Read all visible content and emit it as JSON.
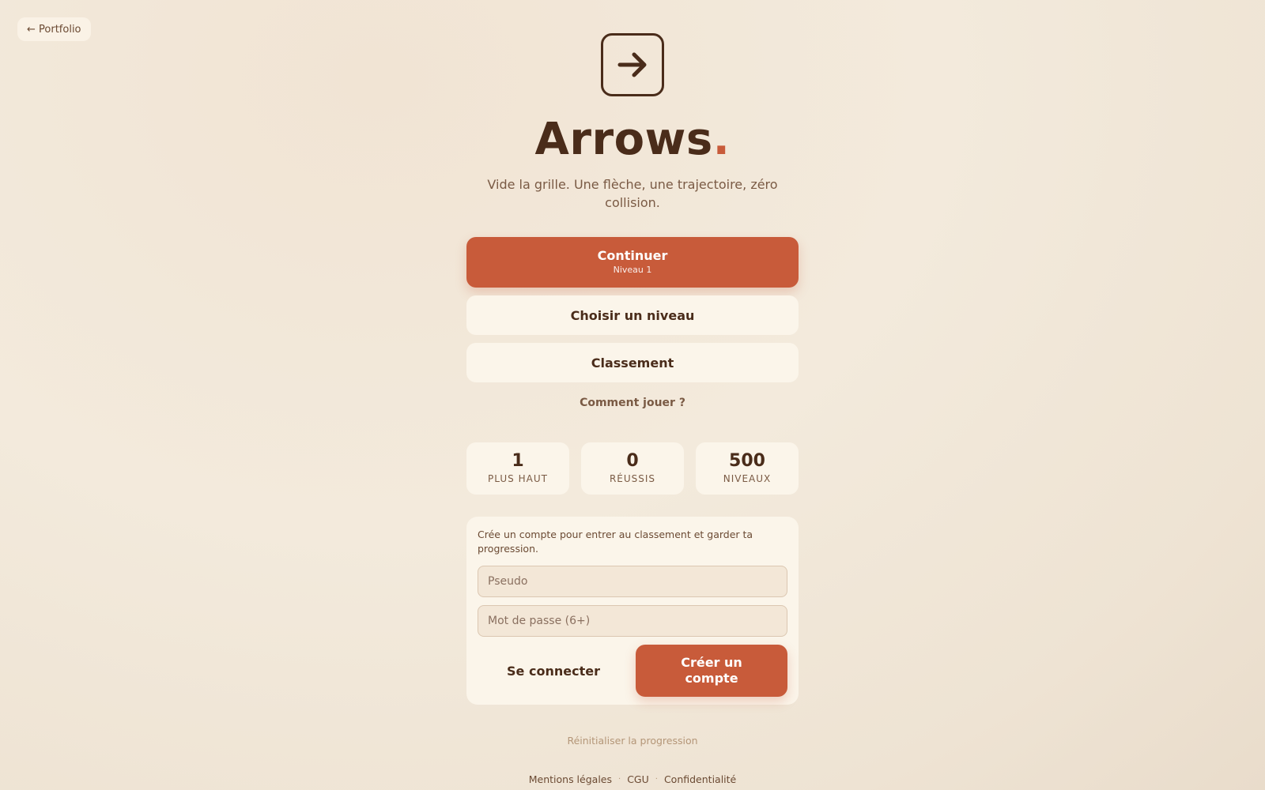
{
  "back_link": {
    "label": "← Portfolio"
  },
  "brand": {
    "title": "Arrows",
    "title_dot": ".",
    "logo_icon": "arrow-right-icon",
    "accent_color": "#c85b3a"
  },
  "tagline": "Vide la grille. Une flèche, une trajectoire, zéro collision.",
  "menu": {
    "continue_label": "Continuer",
    "continue_sub": "Niveau 1",
    "choose_level": "Choisir un niveau",
    "leaderboard": "Classement",
    "how_to_play": "Comment jouer ?"
  },
  "stats": [
    {
      "value": "1",
      "label": "PLUS HAUT"
    },
    {
      "value": "0",
      "label": "RÉUSSIS"
    },
    {
      "value": "500",
      "label": "NIVEAUX"
    }
  ],
  "account": {
    "intro": "Crée un compte pour entrer au classement et garder ta progression.",
    "username_placeholder": "Pseudo",
    "password_placeholder": "Mot de passe (6+)",
    "login_label": "Se connecter",
    "create_label": "Créer un compte"
  },
  "reset_label": "Réinitialiser la progression",
  "footer": {
    "legal": "Mentions légales",
    "terms": "CGU",
    "privacy": "Confidentialité",
    "separator": "·"
  }
}
